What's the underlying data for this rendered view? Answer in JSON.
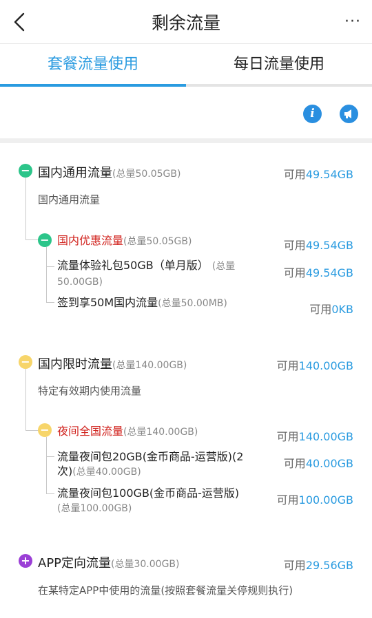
{
  "header": {
    "title": "剩余流量",
    "more_label": "···"
  },
  "tabs": [
    {
      "label": "套餐流量使用",
      "active": true
    },
    {
      "label": "每日流量使用",
      "active": false
    }
  ],
  "toolbar": {
    "info_label": "i"
  },
  "groups": [
    {
      "icon": "minus",
      "title": "国内通用流量",
      "total": "(总量50.05GB)",
      "avail_prefix": "可用",
      "avail_value": "49.54GB",
      "desc": "国内通用流量",
      "sub": {
        "icon": "minus",
        "title": "国内优惠流量",
        "total": "(总量50.05GB)",
        "avail_prefix": "可用",
        "avail_value": "49.54GB",
        "items": [
          {
            "name": "流量体验礼包50GB（单月版）",
            "total": "(总量50.00GB)",
            "avail_prefix": "可用",
            "avail_value": "49.54GB"
          },
          {
            "name": "签到享50M国内流量",
            "total": "(总量50.00MB)",
            "avail_prefix": "可用",
            "avail_value": "0KB"
          }
        ]
      }
    },
    {
      "icon": "minus",
      "title": "国内限时流量",
      "total": "(总量140.00GB)",
      "avail_prefix": "可用",
      "avail_value": "140.00GB",
      "desc": "特定有效期内使用流量",
      "sub": {
        "icon": "minus",
        "title": "夜间全国流量",
        "total": "(总量140.00GB)",
        "avail_prefix": "可用",
        "avail_value": "140.00GB",
        "items": [
          {
            "name": "流量夜间包20GB(金币商品-运营版)(2次)",
            "total": "(总量40.00GB)",
            "avail_prefix": "可用",
            "avail_value": "40.00GB"
          },
          {
            "name": "流量夜间包100GB(金币商品-运营版)",
            "total": "(总量100.00GB)",
            "avail_prefix": "可用",
            "avail_value": "100.00GB"
          }
        ]
      }
    },
    {
      "icon": "plus",
      "title": "APP定向流量",
      "total": "(总量30.00GB)",
      "avail_prefix": "可用",
      "avail_value": "29.56GB",
      "desc": "在某特定APP中使用的流量(按照套餐流量关停规则执行)"
    }
  ],
  "colors": {
    "accent": "#2a9be0",
    "green": "#2cc58a",
    "yellow": "#f7d56a",
    "purple": "#9b3fd6",
    "red": "#d0201b"
  }
}
